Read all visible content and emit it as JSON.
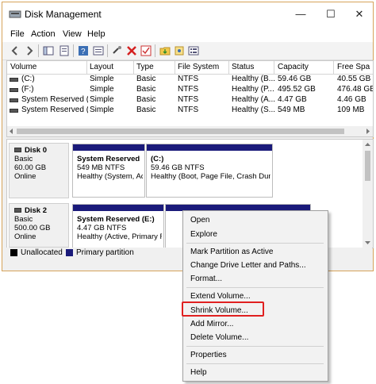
{
  "window": {
    "title": "Disk Management",
    "controls": {
      "minimize": "—",
      "maximize": "☐",
      "close": "✕"
    }
  },
  "menu": [
    "File",
    "Action",
    "View",
    "Help"
  ],
  "toolbar_icons": [
    "back-icon",
    "forward-icon",
    "show-hide-tree-icon",
    "properties-icon",
    "help-icon",
    "connect-icon",
    "delete-icon",
    "check-icon",
    "folder-icon",
    "wizard-icon",
    "list-icon"
  ],
  "volume_table": {
    "columns": [
      "Volume",
      "Layout",
      "Type",
      "File System",
      "Status",
      "Capacity",
      "Free Spa"
    ],
    "rows": [
      [
        "(C:)",
        "Simple",
        "Basic",
        "NTFS",
        "Healthy (B...",
        "59.46 GB",
        "40.55 GB"
      ],
      [
        "(F:)",
        "Simple",
        "Basic",
        "NTFS",
        "Healthy (P...",
        "495.52 GB",
        "476.48 GB"
      ],
      [
        "System Reserved (...",
        "Simple",
        "Basic",
        "NTFS",
        "Healthy (A...",
        "4.47 GB",
        "4.46 GB"
      ],
      [
        "System Reserved (...",
        "Simple",
        "Basic",
        "NTFS",
        "Healthy (S...",
        "549 MB",
        "109 MB"
      ]
    ]
  },
  "disks": [
    {
      "name": "Disk 0",
      "type": "Basic",
      "size": "60.00 GB",
      "state": "Online",
      "partitions": [
        {
          "name": "System Reserved",
          "size": "549 MB NTFS",
          "status": "Healthy (System, Ac"
        },
        {
          "name": "(C:)",
          "size": "59.46 GB NTFS",
          "status": "Healthy (Boot, Page File, Crash Dum"
        }
      ]
    },
    {
      "name": "Disk 2",
      "type": "Basic",
      "size": "500.00 GB",
      "state": "Online",
      "partitions": [
        {
          "name": "System Reserved  (E:)",
          "size": "4.47 GB NTFS",
          "status": "Healthy (Active, Primary F"
        }
      ]
    }
  ],
  "legend": [
    {
      "label": "Unallocated",
      "color": "#000000"
    },
    {
      "label": "Primary partition",
      "color": "#1a1a7a"
    }
  ],
  "context_menu": {
    "groups": [
      [
        "Open",
        "Explore"
      ],
      [
        "Mark Partition as Active",
        "Change Drive Letter and Paths...",
        "Format..."
      ],
      [
        "Extend Volume...",
        "Shrink Volume...",
        "Add Mirror...",
        "Delete Volume..."
      ],
      [
        "Properties"
      ],
      [
        "Help"
      ]
    ],
    "highlighted": "Shrink Volume..."
  },
  "colors": {
    "primary_partition": "#1a1a7a",
    "highlight_box": "#e02020",
    "window_border": "#d6a35a"
  }
}
